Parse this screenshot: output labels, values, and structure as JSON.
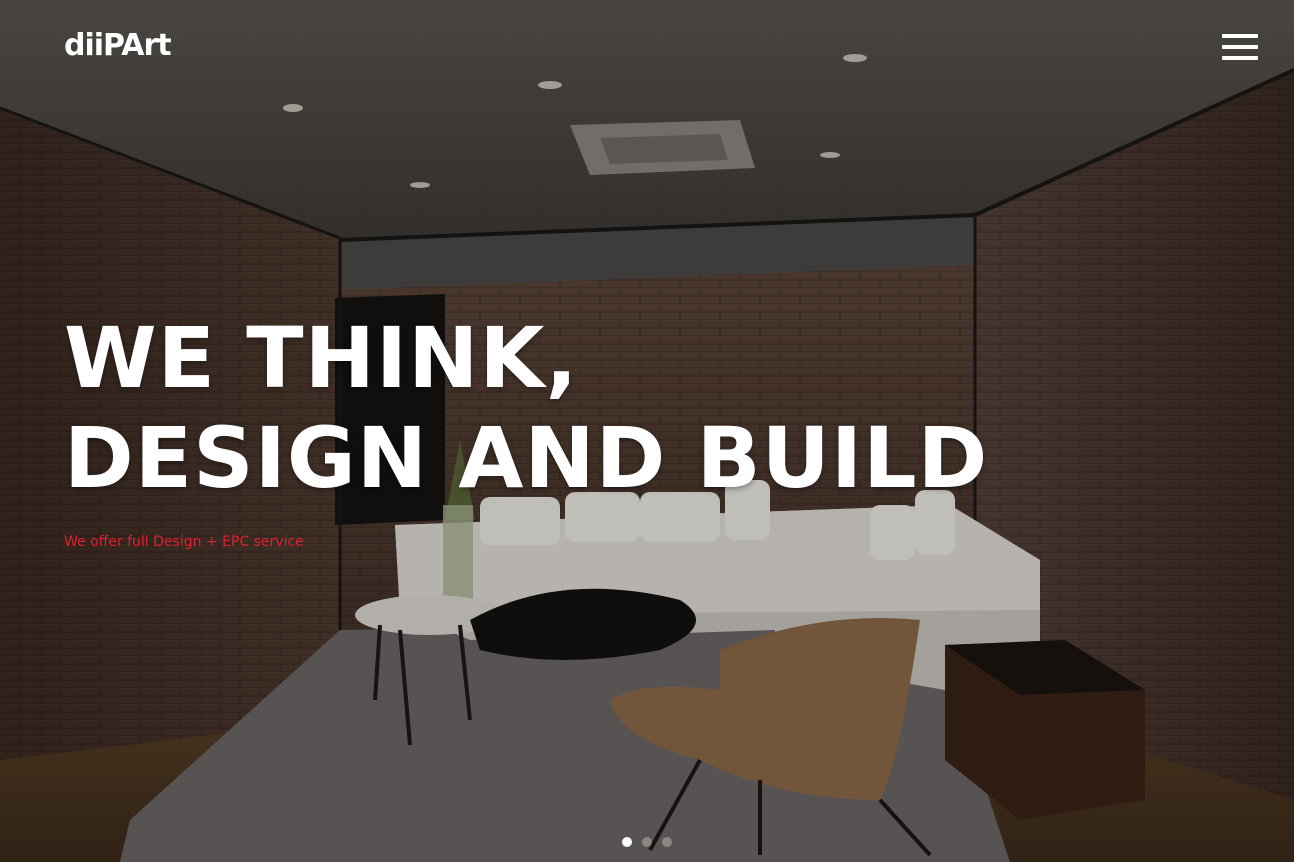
{
  "header": {
    "logo_text": "diiPArt",
    "menu_icon": "hamburger-menu-icon"
  },
  "hero": {
    "headline_line1": "WE THINK,",
    "headline_line2": "DESIGN AND BUILD",
    "subline": "We offer full Design + EPC service"
  },
  "slider": {
    "total_slides": 3,
    "active_index": 0
  },
  "colors": {
    "accent": "#e0202e",
    "text": "#ffffff",
    "dot_active": "#ffffff",
    "dot_inactive": "#8a8682"
  }
}
